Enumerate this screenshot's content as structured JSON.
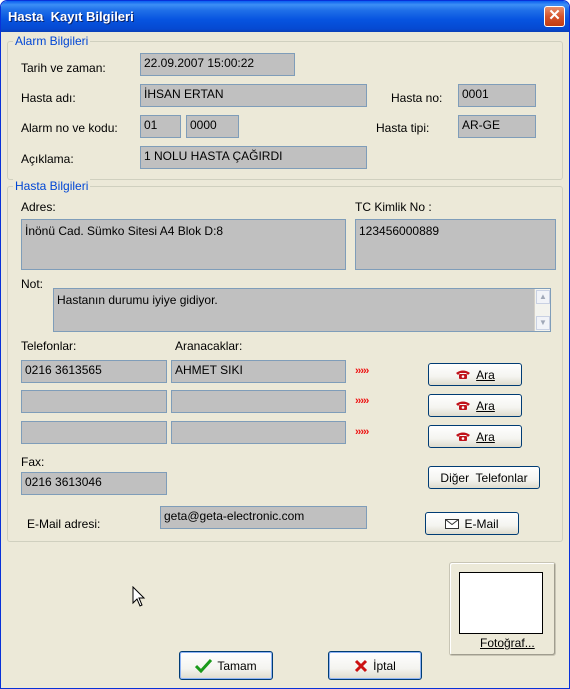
{
  "window": {
    "title": "Hasta  Kayıt Bilgileri",
    "close_glyph": "✕"
  },
  "alarm": {
    "legend": "Alarm Bilgileri",
    "datetime_label": "Tarih ve zaman:",
    "datetime_value": "22.09.2007 15:00:22",
    "patient_name_label": "Hasta adı:",
    "patient_name_value": "İHSAN ERTAN",
    "patient_no_label": "Hasta no:",
    "patient_no_value": "0001",
    "alarm_no_label": "Alarm no ve kodu:",
    "alarm_no_value": "01",
    "alarm_code_value": "0000",
    "patient_type_label": "Hasta tipi:",
    "patient_type_value": "AR-GE",
    "description_label": "Açıklama:",
    "description_value": "1 NOLU HASTA ÇAĞIRDI"
  },
  "patient": {
    "legend": "Hasta Bilgileri",
    "address_label": "Adres:",
    "address_value": "İnönü Cad. Sümko Sitesi A4 Blok D:8",
    "tc_label": "TC Kimlik No :",
    "tc_value": "123456000889",
    "note_label": "Not:",
    "note_value": "Hastanın durumu iyiye gidiyor.",
    "phones_label": "Telefonlar:",
    "callers_label": "Aranacaklar:",
    "phones": [
      {
        "phone": "0216 3613565",
        "caller": "AHMET SIKI"
      },
      {
        "phone": "",
        "caller": ""
      },
      {
        "phone": "",
        "caller": ""
      }
    ],
    "arrows": "›››››",
    "call_button": "Ara",
    "fax_label": "Fax:",
    "fax_value": "0216 3613046",
    "other_phones_button": "Diğer  Telefonlar",
    "email_label": "E-Mail adresi:",
    "email_value": "geta@geta-electronic.com",
    "email_button": "E-Mail"
  },
  "photo_button": "Fotoğraf...",
  "ok_button": "Tamam",
  "cancel_button": "İptal",
  "colors": {
    "legend": "#0046d5",
    "field_bg": "#c0c0c0",
    "arrow_red": "#e11"
  }
}
